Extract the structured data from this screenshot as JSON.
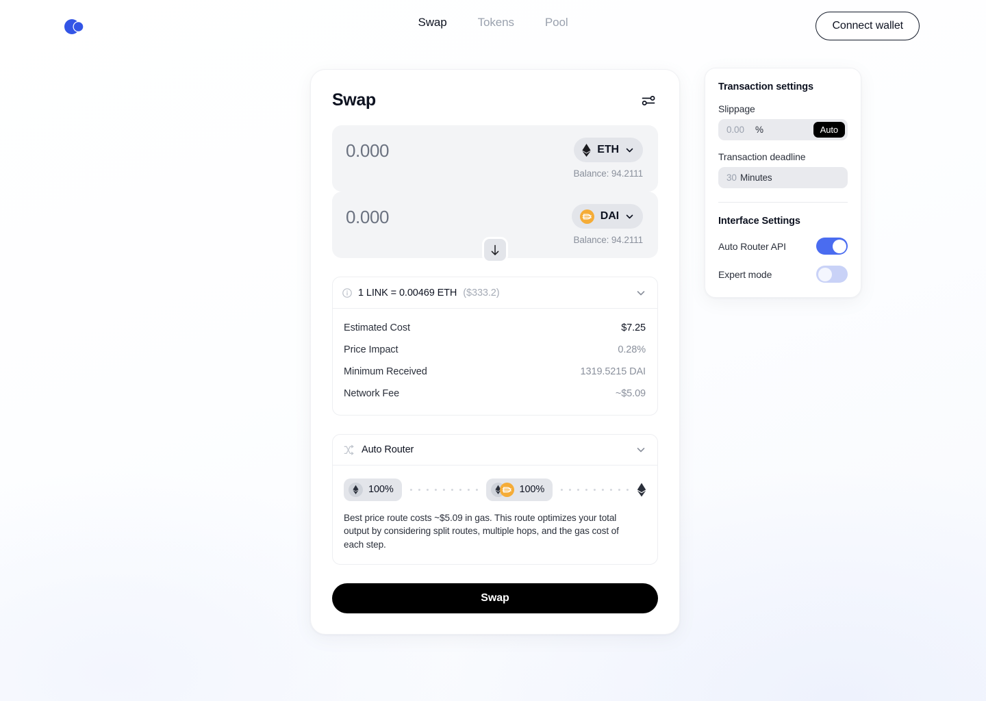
{
  "header": {
    "logo_name": "app-logo",
    "nav": [
      {
        "label": "Swap",
        "active": true
      },
      {
        "label": "Tokens",
        "active": false
      },
      {
        "label": "Pool",
        "active": false
      }
    ],
    "connect_wallet_label": "Connect wallet"
  },
  "swap": {
    "title": "Swap",
    "settings_icon": "sliders-icon",
    "swap_direction_icon": "arrow-down-icon",
    "from": {
      "amount_value": "",
      "amount_placeholder": "0.000",
      "token_symbol": "ETH",
      "token_icon": "ethereum-icon",
      "balance": "Balance: 94.2111"
    },
    "to": {
      "amount_value": "",
      "amount_placeholder": "0.000",
      "token_symbol": "DAI",
      "token_icon": "dai-icon",
      "balance": "Balance: 94.2111"
    },
    "rate": {
      "info_icon": "info-icon",
      "text": "1 LINK = 0.00469 ETH",
      "usd": "($333.2)",
      "chevron_icon": "chevron-down-icon"
    },
    "details": [
      {
        "label": "Estimated Cost",
        "value": "$7.25",
        "emphasis": true
      },
      {
        "label": "Price Impact",
        "value": "0.28%",
        "emphasis": false
      },
      {
        "label": "Minimum Received",
        "value": "1319.5215 DAI",
        "emphasis": false
      },
      {
        "label": "Network Fee",
        "value": "~$5.09",
        "emphasis": false
      }
    ],
    "router": {
      "icon": "shuffle-icon",
      "title": "Auto Router",
      "chevron_icon": "chevron-down-icon",
      "hops": [
        {
          "percent": "100%",
          "icons": [
            "ethereum-icon"
          ]
        },
        {
          "percent": "100%",
          "icons": [
            "ethereum-icon",
            "dai-icon"
          ]
        }
      ],
      "end_icon": "ethereum-icon",
      "note": "Best price route costs ~$5.09 in gas. This route optimizes your total output by considering split routes, multiple hops, and the gas cost of each step."
    },
    "submit_label": "Swap"
  },
  "settings": {
    "title": "Transaction settings",
    "slippage": {
      "label": "Slippage",
      "value": "",
      "placeholder": "0.00",
      "unit": "%",
      "auto_label": "Auto"
    },
    "deadline": {
      "label": "Transaction deadline",
      "value": "",
      "placeholder": "30",
      "unit": "Minutes"
    },
    "interface_title": "Interface Settings",
    "toggles": [
      {
        "label": "Auto Router API",
        "on": true
      },
      {
        "label": "Expert mode",
        "on": false
      }
    ]
  },
  "colors": {
    "accent_blue": "#3355e6",
    "toggle_on": "#4a6cf0",
    "toggle_off": "#c9d2f7",
    "dai_yellow": "#f5ac37",
    "panel_gray": "#f3f4f6",
    "pill_gray": "#e3e5ea",
    "black": "#000000"
  }
}
